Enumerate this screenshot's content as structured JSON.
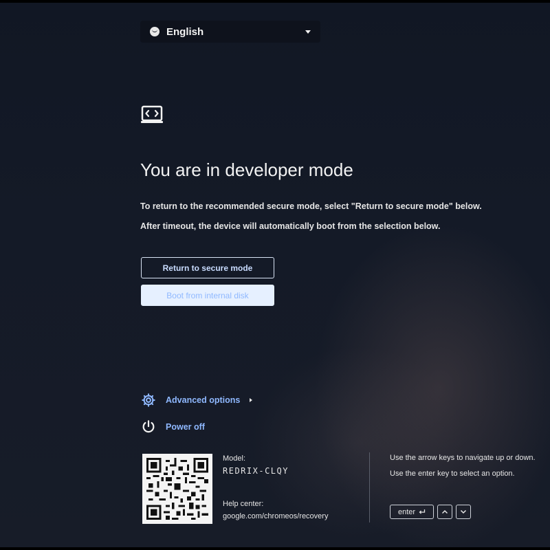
{
  "language": {
    "selected": "English",
    "icon": "globe-icon"
  },
  "heading": {
    "title": "You are in developer mode",
    "line1": "To return to the recommended secure mode, select \"Return to secure mode\" below.",
    "line2": "After timeout, the device will automatically boot from the selection below."
  },
  "buttons": {
    "return_secure": "Return to secure mode",
    "boot_internal": "Boot from internal disk"
  },
  "links": {
    "advanced": "Advanced options",
    "power": "Power off"
  },
  "footer": {
    "model_label": "Model:",
    "model_value": "REDRIX-CLQY",
    "help_label": "Help center:",
    "help_value": "google.com/chromeos/recovery",
    "hint1": "Use the arrow keys to navigate up or down.",
    "hint2": "Use the enter key to select an option.",
    "enter_key": "enter"
  },
  "colors": {
    "accent": "#8fb8ff",
    "background": "#141a27",
    "selected_button_bg": "#e6f0ff"
  }
}
